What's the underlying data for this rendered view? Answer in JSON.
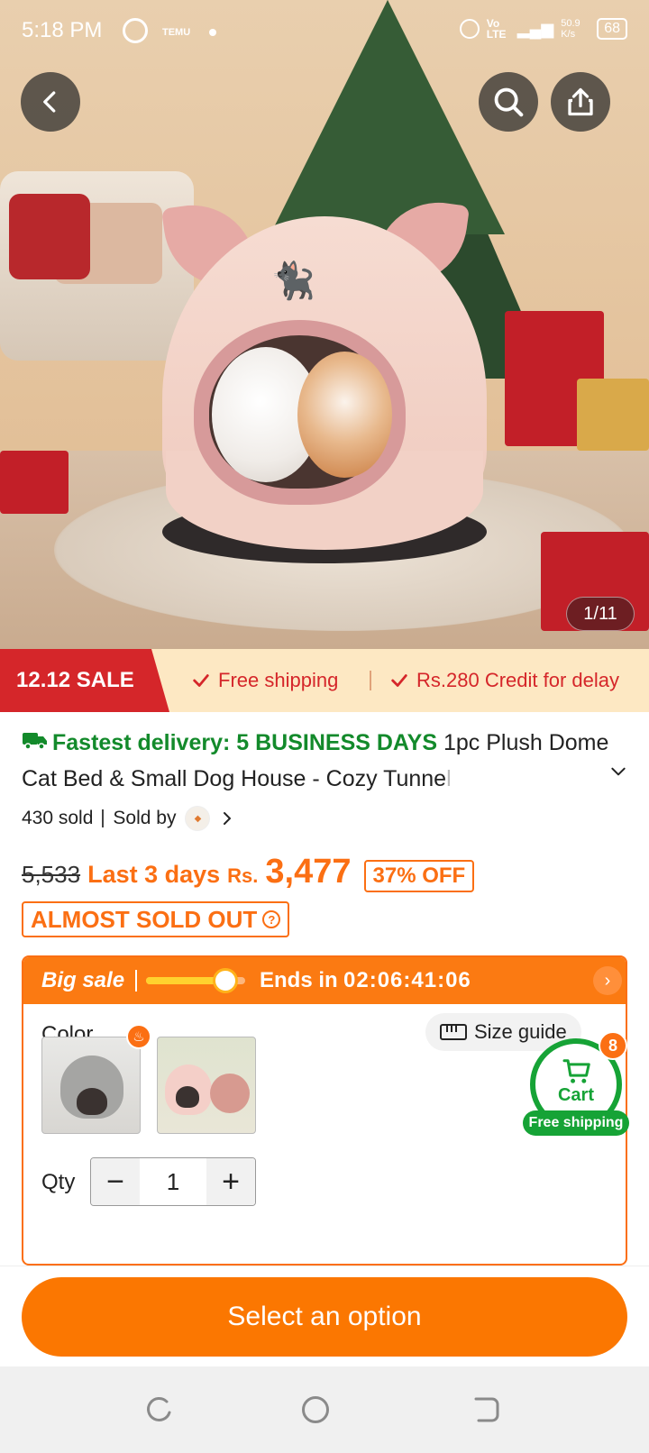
{
  "status_bar": {
    "time": "5:18 PM",
    "temu_label": "TEMU",
    "network": "Vo LTE",
    "speed": "50.9 K/s",
    "battery": "68"
  },
  "hero": {
    "image_counter": "1/11",
    "back_icon": "chevron-left-icon",
    "search_icon": "search-icon",
    "share_icon": "share-icon"
  },
  "sale_strip": {
    "badge": "12.12 SALE",
    "free_shipping": "Free shipping",
    "credit": "Rs.280 Credit for delay"
  },
  "product": {
    "delivery": "Fastest delivery: 5 BUSINESS DAYS",
    "title_main": " 1pc Plush Dome Cat Bed & Small Dog House - Cozy Tunne",
    "title_fade": "l",
    "sold": "430 sold",
    "sold_by": "Sold by"
  },
  "price": {
    "old": "5,533",
    "last_days": "Last 3 days",
    "currency": "Rs.",
    "current": "3,477",
    "discount": "37% OFF",
    "stock_warning": "ALMOST SOLD OUT"
  },
  "big_sale": {
    "label": "Big sale",
    "progress": 0.7,
    "ends_in": "Ends in",
    "countdown": "02:06:41:06"
  },
  "options": {
    "color_label": "Color",
    "size_guide": "Size guide",
    "qty_label": "Qty",
    "qty_value": "1",
    "minus": "−",
    "plus": "+"
  },
  "cart": {
    "count": "8",
    "label": "Cart",
    "free_shipping": "Free shipping"
  },
  "cta": {
    "label": "Select an option"
  },
  "colors": {
    "accent": "#fb7701",
    "sale_red": "#d5262a",
    "delivery_green": "#138a2b",
    "cart_green": "#16a336"
  }
}
